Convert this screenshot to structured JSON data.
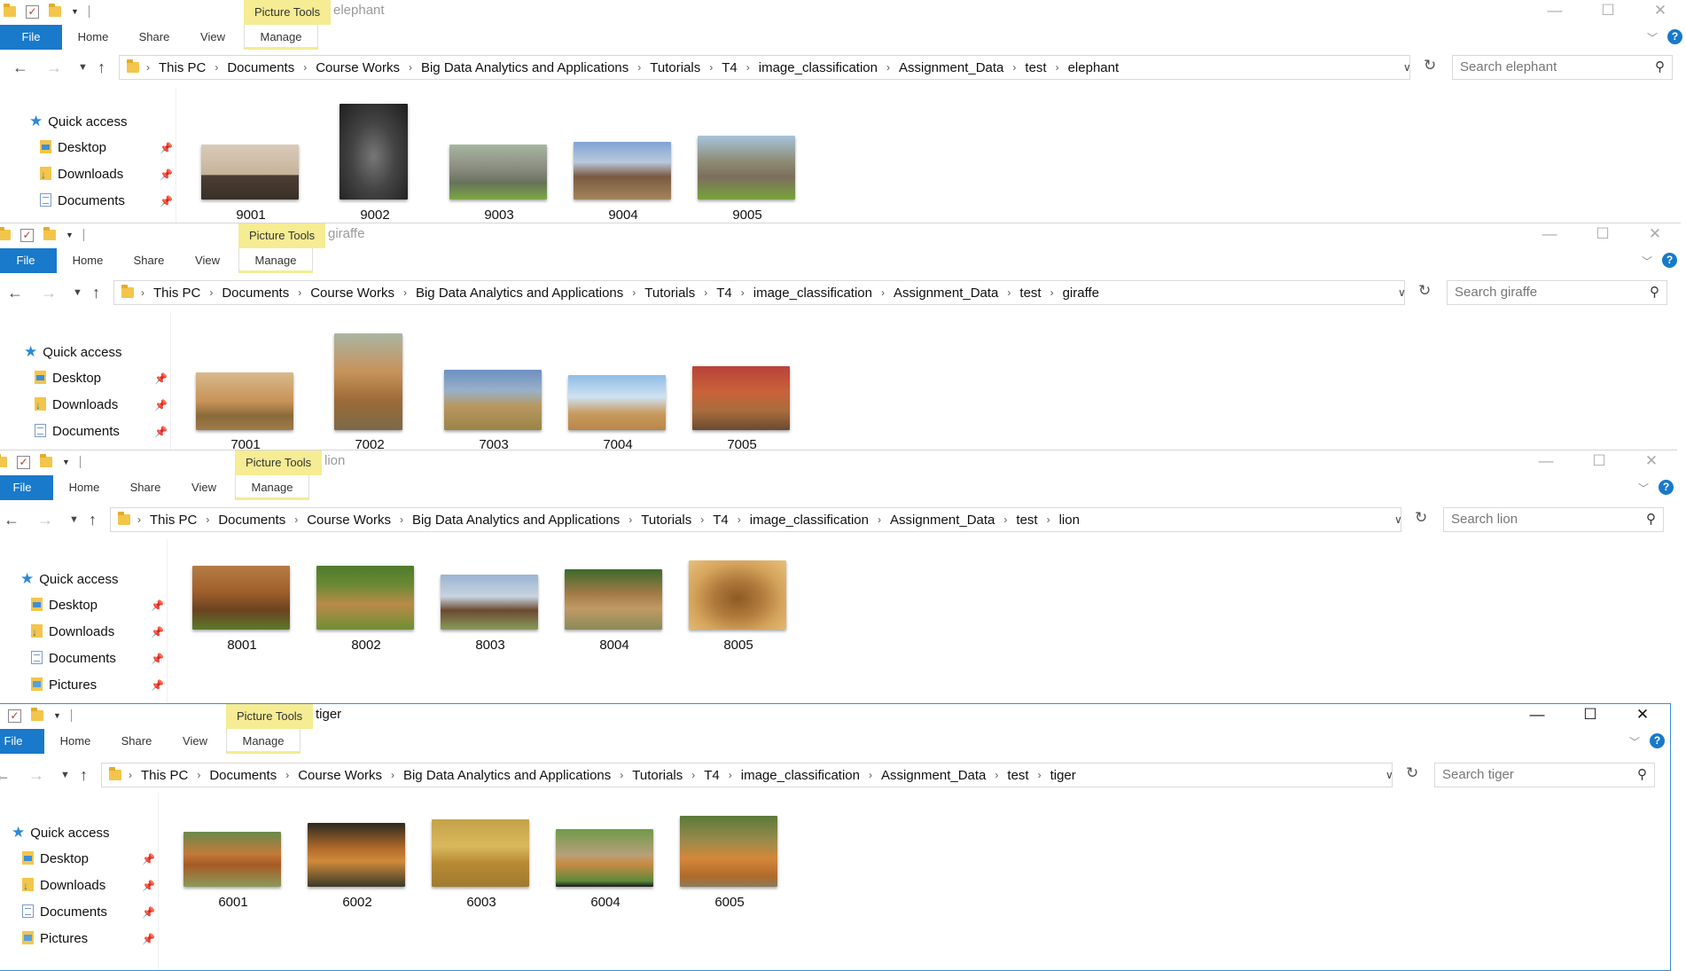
{
  "common": {
    "picture_tools": "Picture Tools",
    "tabs": {
      "file": "File",
      "home": "Home",
      "share": "Share",
      "view": "View",
      "manage": "Manage"
    },
    "path": [
      "This PC",
      "Documents",
      "Course Works",
      "Big Data Analytics and Applications",
      "Tutorials",
      "T4",
      "image_classification",
      "Assignment_Data",
      "test"
    ],
    "help": "?",
    "quick_access": "Quick access",
    "desktop": "Desktop",
    "downloads": "Downloads",
    "documents": "Documents",
    "pictures": "Pictures"
  },
  "windows": {
    "elephant": {
      "title": "elephant",
      "folder": "elephant",
      "search_placeholder": "Search elephant",
      "files": [
        "9001",
        "9002",
        "9003",
        "9004",
        "9005"
      ]
    },
    "giraffe": {
      "title": "giraffe",
      "folder": "giraffe",
      "search_placeholder": "Search giraffe",
      "files": [
        "7001",
        "7002",
        "7003",
        "7004",
        "7005"
      ]
    },
    "lion": {
      "title": "lion",
      "folder": "lion",
      "search_placeholder": "Search lion",
      "files": [
        "8001",
        "8002",
        "8003",
        "8004",
        "8005"
      ]
    },
    "tiger": {
      "title": "tiger",
      "folder": "tiger",
      "search_placeholder": "Search tiger",
      "files": [
        "6001",
        "6002",
        "6003",
        "6004",
        "6005"
      ]
    }
  },
  "colors": {
    "file_tab": "#1979ca",
    "picture_tools_bg": "#f5ec93",
    "active_border": "#3b8fd8",
    "quick_access_star": "#2b88d8"
  }
}
